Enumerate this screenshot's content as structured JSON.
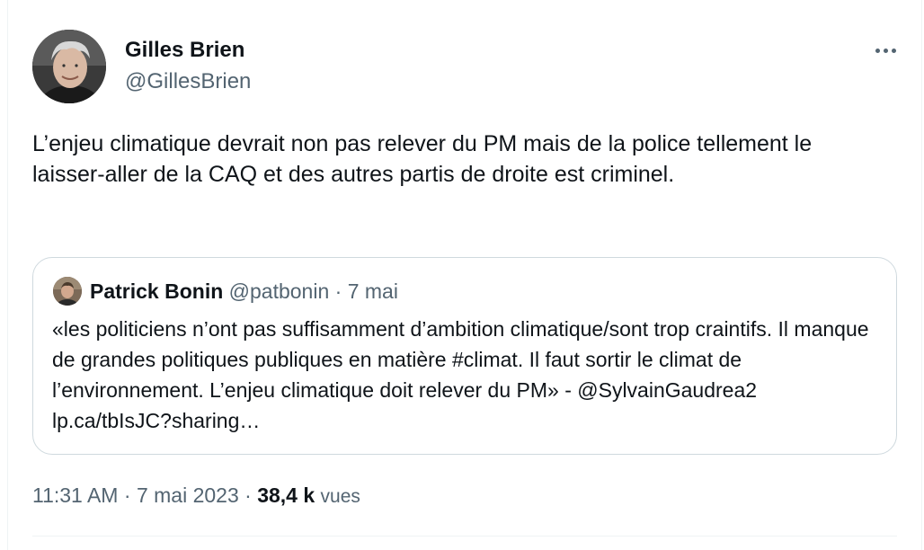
{
  "author": {
    "name": "Gilles Brien",
    "handle": "@GillesBrien",
    "avatar_icon": "user-avatar-photo"
  },
  "more_icon": "more-horizontal-icon",
  "tweet_text": "L’enjeu climatique devrait non pas relever du PM mais de la police tellement le laisser-aller de la CAQ et des autres partis de droite est criminel.",
  "quoted_tweet": {
    "name": "Patrick Bonin",
    "handle": "@patbonin",
    "separator": "·",
    "date": "7 mai",
    "text": "«les politiciens n’ont pas suffisamment d’ambition climatique/sont trop craintifs. Il manque de grandes politiques publiques en matière #climat. Il faut sortir le climat de l’environnement. L’enjeu climatique doit relever du PM» - @SylvainGaudrea2 lp.ca/tbIsJC?sharing…"
  },
  "meta": {
    "time": "11:31 AM",
    "sep1": "·",
    "date": "7 mai 2023",
    "sep2": "·",
    "views_count": "38,4 k",
    "views_label": "vues"
  },
  "colors": {
    "text_primary": "#0f1419",
    "text_secondary": "#536471",
    "border": "#cfd9de",
    "divider": "#eff3f4"
  }
}
